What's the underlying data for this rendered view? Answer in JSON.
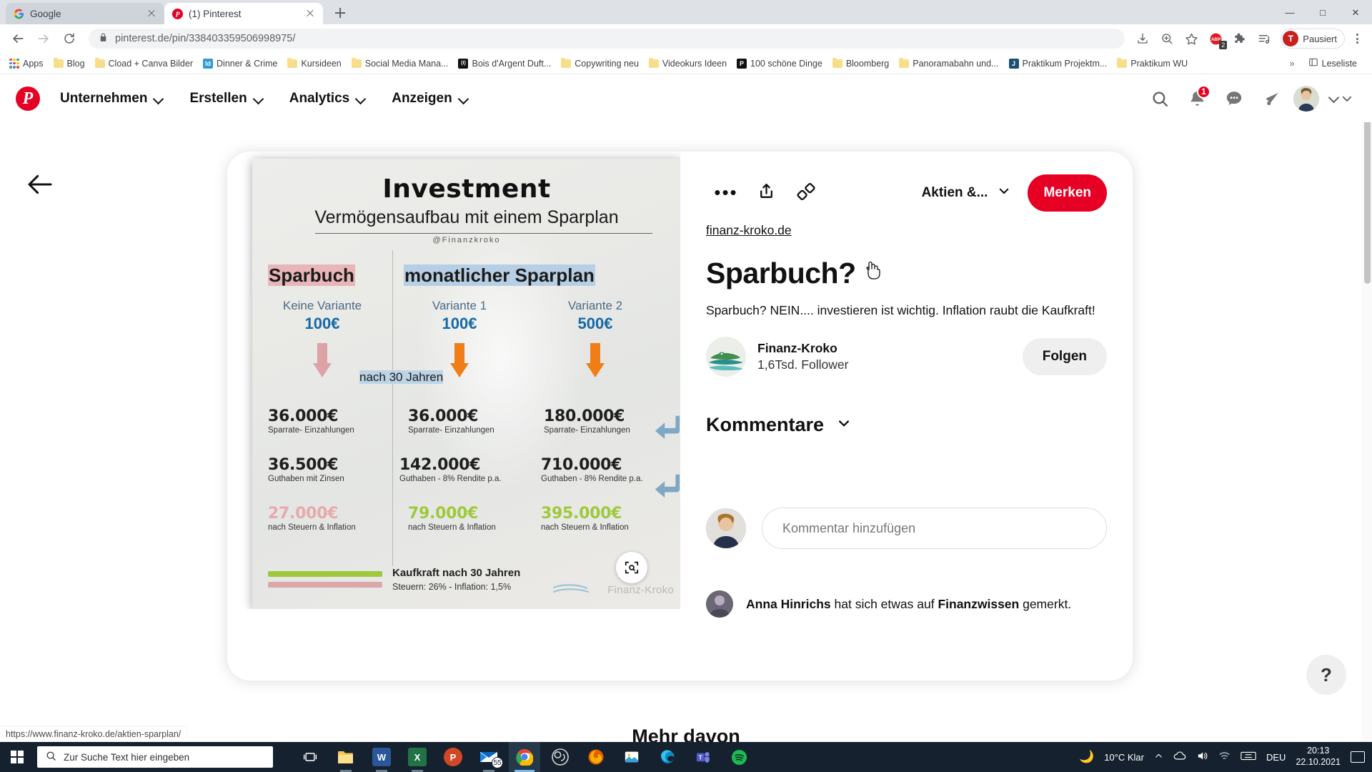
{
  "browser": {
    "tabs": [
      {
        "title": "Google",
        "favicon": "google-icon",
        "active": false
      },
      {
        "title": "(1) Pinterest",
        "favicon": "pinterest-icon",
        "active": true
      }
    ],
    "newtab_label": "+",
    "window_controls": {
      "minimize": "—",
      "maximize": "□",
      "close": "✕"
    },
    "omnibox": {
      "domain": "pinterest.de",
      "path": "/pin/338403359506998975/",
      "full_url": "pinterest.de/pin/338403359506998975/",
      "lock_icon": "lock-icon"
    },
    "toolbar_icons": [
      "install-icon",
      "zoom-icon",
      "bookmark-star-icon",
      "adblock-icon",
      "extensions-icon",
      "reading-list-icon"
    ],
    "adblock_count": "2",
    "profile": {
      "initial": "T",
      "label": "Pausiert"
    },
    "bookmarks": [
      {
        "label": "Apps",
        "icon": "apps-grid-icon"
      },
      {
        "label": "Blog",
        "icon": "folder-icon"
      },
      {
        "label": "Cload + Canva Bilder",
        "icon": "folder-icon"
      },
      {
        "label": "Dinner & Crime",
        "icon": "indesign-icon",
        "icon_text": "Id",
        "icon_color": "#2e9bd6"
      },
      {
        "label": "Kursideen",
        "icon": "folder-icon"
      },
      {
        "label": "Social Media Mana...",
        "icon": "folder-icon"
      },
      {
        "label": "Bois d'Argent Duft...",
        "icon": "dark-site-icon",
        "icon_text": "(I)",
        "icon_color": "#111111"
      },
      {
        "label": "Copywriting neu",
        "icon": "folder-icon"
      },
      {
        "label": "Videokurs Ideen",
        "icon": "folder-icon"
      },
      {
        "label": "100 schöne Dinge",
        "icon": "dark-site-icon",
        "icon_text": "P",
        "icon_color": "#111111"
      },
      {
        "label": "Bloomberg",
        "icon": "folder-icon"
      },
      {
        "label": "Panoramabahn und...",
        "icon": "folder-icon"
      },
      {
        "label": "Praktikum Projektm...",
        "icon": "site-icon",
        "icon_text": "J",
        "icon_color": "#1d4f72"
      },
      {
        "label": "Praktikum WU",
        "icon": "folder-icon"
      }
    ],
    "bookmarks_overflow": "»",
    "reading_list_label": "Leseliste",
    "status_bar_url": "https://www.finanz-kroko.de/aktien-sparplan/"
  },
  "pinterest": {
    "logo": "pinterest-logo-icon",
    "nav": [
      {
        "label": "Unternehmen"
      },
      {
        "label": "Erstellen"
      },
      {
        "label": "Analytics"
      },
      {
        "label": "Anzeigen"
      }
    ],
    "header_icons": [
      {
        "name": "search-icon"
      },
      {
        "name": "notifications-bell-icon",
        "badge": "1"
      },
      {
        "name": "messages-icon"
      },
      {
        "name": "announcements-megaphone-icon"
      }
    ],
    "account_chevron": "chevron-down-icon",
    "back_arrow": "back-arrow-icon"
  },
  "pin": {
    "actions": {
      "more_label": "•••",
      "share_icon": "share-upload-icon",
      "link_icon": "chain-link-icon",
      "board_name": "Aktien &...",
      "board_chevron": "chevron-down-icon",
      "save_label": "Merken"
    },
    "source_link": "finanz-kroko.de",
    "title": "Sparbuch?",
    "description": "Sparbuch? NEIN.... investieren ist wichtig. Inflation raubt die Kaufkraft!",
    "author": {
      "name": "Finanz-Kroko",
      "followers": "1,6Tsd. Follower",
      "follow_label": "Folgen",
      "avatar": "crocodile-avatar"
    },
    "comments": {
      "heading": "Kommentare",
      "chevron": "chevron-down-icon",
      "input_placeholder": "Kommentar hinzufügen",
      "activity": {
        "user": "Anna Hinrichs",
        "middle": " hat sich etwas auf ",
        "board": "Finanzwissen",
        "end": " gemerkt."
      }
    },
    "zoom_icon": "image-zoom-icon",
    "more_section_title": "Mehr davon",
    "help_label": "?"
  },
  "infographic": {
    "title": "Investment",
    "subtitle": "Vermögensaufbau mit einem Sparplan",
    "handle": "@Finanzkroko",
    "heading_left": "Sparbuch",
    "heading_right": "monatlicher Sparplan",
    "middle_label": "nach 30 Jahren",
    "columns": [
      {
        "variant": "Keine Variante",
        "amount": "100€",
        "arrow_color": "#dda2a5",
        "rows": [
          {
            "value": "36.000€",
            "caption": "Sparrate- Einzahlungen",
            "color": "#1f1f1f"
          },
          {
            "value": "36.500€",
            "caption": "Guthaben mit Zinsen",
            "color": "#1f1f1f"
          },
          {
            "value": "27.000€",
            "caption": "nach Steuern & Inflation",
            "color": "#e8a9ac"
          }
        ]
      },
      {
        "variant": "Variante 1",
        "amount": "100€",
        "arrow_color": "#f07d16",
        "rows": [
          {
            "value": "36.000€",
            "caption": "Sparrate- Einzahlungen",
            "color": "#1f1f1f"
          },
          {
            "value": "142.000€",
            "caption": "Guthaben - 8% Rendite p.a.",
            "color": "#1f1f1f"
          },
          {
            "value": "79.000€",
            "caption": "nach Steuern & Inflation",
            "color": "#9ec93c"
          }
        ]
      },
      {
        "variant": "Variante 2",
        "amount": "500€",
        "arrow_color": "#f07d16",
        "rows": [
          {
            "value": "180.000€",
            "caption": "Sparrate- Einzahlungen",
            "color": "#1f1f1f"
          },
          {
            "value": "710.000€",
            "caption": "Guthaben - 8% Rendite p.a.",
            "color": "#1f1f1f"
          },
          {
            "value": "395.000€",
            "caption": "nach Steuern & Inflation",
            "color": "#9ec93c"
          }
        ]
      }
    ],
    "footer_title": "Kaufkraft nach 30 Jahren",
    "footer_sub": "Steuern: 26% - Inflation: 1,5%",
    "watermark": "Finanz-Kroko"
  },
  "taskbar": {
    "search_placeholder": "Zur Suche Text hier eingeben",
    "task_view": "task-view-icon",
    "apps": [
      {
        "name": "file-explorer-icon",
        "label": ""
      },
      {
        "name": "word-icon",
        "label": "W",
        "color": "#2b579a"
      },
      {
        "name": "excel-icon",
        "label": "X",
        "color": "#217346"
      },
      {
        "name": "powerpoint-icon",
        "label": "P",
        "color": "#d24726"
      },
      {
        "name": "mail-icon",
        "label": "55",
        "color": "#0a67c0"
      },
      {
        "name": "chrome-icon",
        "label": "",
        "color": "#ffffff"
      },
      {
        "name": "obs-icon",
        "label": "",
        "color": "#333333"
      },
      {
        "name": "firefox-icon",
        "label": "",
        "color": "#e66000"
      },
      {
        "name": "photos-icon",
        "label": "",
        "color": "#0a84c1"
      },
      {
        "name": "edge-icon",
        "label": "",
        "color": "#0f8ac6"
      },
      {
        "name": "teams-icon",
        "label": "",
        "color": "#5059c9"
      },
      {
        "name": "spotify-icon",
        "label": "",
        "color": "#1db954"
      }
    ],
    "tray": {
      "weather_icon": "moon-icon",
      "weather": "10°C  Klar",
      "chevron": "show-hidden-icons-icon",
      "onedrive": "onedrive-icon",
      "volume": "volume-icon",
      "network": "wifi-icon",
      "keyboard": "keyboard-icon",
      "language": "DEU",
      "time": "20:13",
      "date": "22.10.2021",
      "notifications": "notification-center-icon"
    }
  }
}
